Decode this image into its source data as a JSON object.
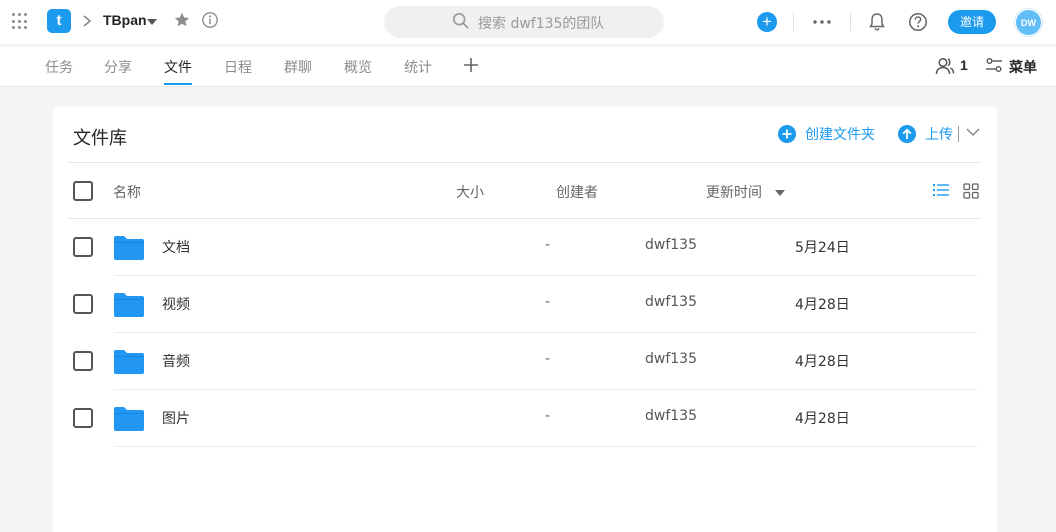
{
  "topbar": {
    "app_logo_letter": "t",
    "project_name": "TBpan",
    "search_placeholder": "搜索 dwf135的团队",
    "add_symbol": "+",
    "invite_label": "邀请",
    "avatar_initials": "DW"
  },
  "tabs": [
    {
      "label": "任务",
      "active": false
    },
    {
      "label": "分享",
      "active": false
    },
    {
      "label": "文件",
      "active": true
    },
    {
      "label": "日程",
      "active": false
    },
    {
      "label": "群聊",
      "active": false
    },
    {
      "label": "概览",
      "active": false
    },
    {
      "label": "统计",
      "active": false
    }
  ],
  "tabbar_right": {
    "members_count": "1",
    "menu_label": "菜单"
  },
  "library": {
    "title": "文件库",
    "create_folder_label": "创建文件夹",
    "upload_label": "上传",
    "columns": {
      "name": "名称",
      "size": "大小",
      "creator": "创建者",
      "updated": "更新时间"
    },
    "rows": [
      {
        "name": "文档",
        "size": "-",
        "creator": "dwf135",
        "updated": "5月24日"
      },
      {
        "name": "视频",
        "size": "-",
        "creator": "dwf135",
        "updated": "4月28日"
      },
      {
        "name": "音频",
        "size": "-",
        "creator": "dwf135",
        "updated": "4月28日"
      },
      {
        "name": "图片",
        "size": "-",
        "creator": "dwf135",
        "updated": "4月28日"
      }
    ]
  },
  "colors": {
    "accent": "#1b9aee",
    "folder": "#2196f3",
    "avatar": "#61bdf5"
  }
}
